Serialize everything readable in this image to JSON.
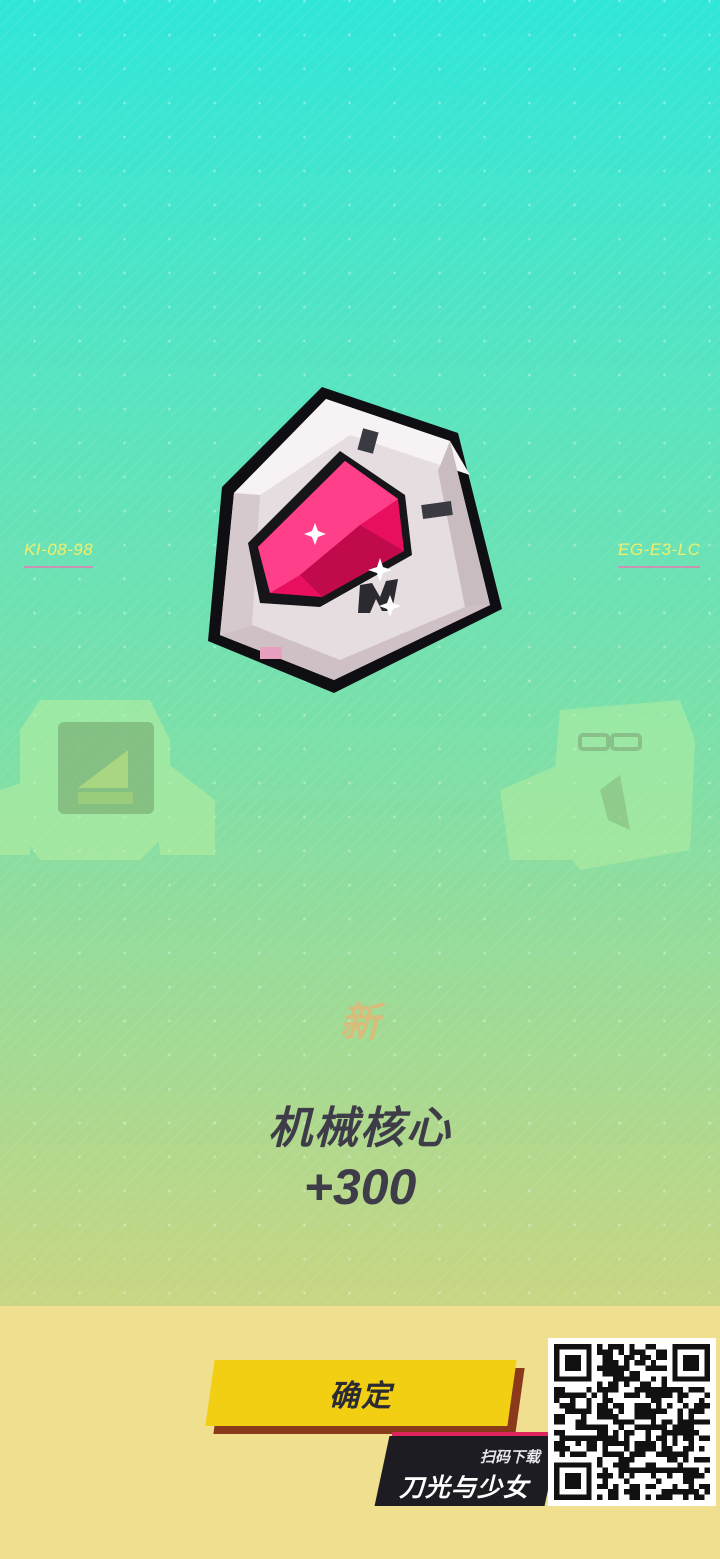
{
  "background": {
    "top_color": "#2fe6d9",
    "bottom_color": "#e6db7d"
  },
  "tags": {
    "left": "KI-08-98",
    "right": "EG-E3-LC"
  },
  "reward": {
    "new_label": "新",
    "item_name": "机械核心",
    "amount": "+300",
    "icon": "mech-core-gem-icon",
    "gem_color": "#e8105e"
  },
  "confirm_label": "确定",
  "promo": {
    "scan_text": "扫码下载",
    "game_title": "刀光与少女",
    "accent": "#e0245e"
  },
  "qr_icon": "qr-code-icon"
}
